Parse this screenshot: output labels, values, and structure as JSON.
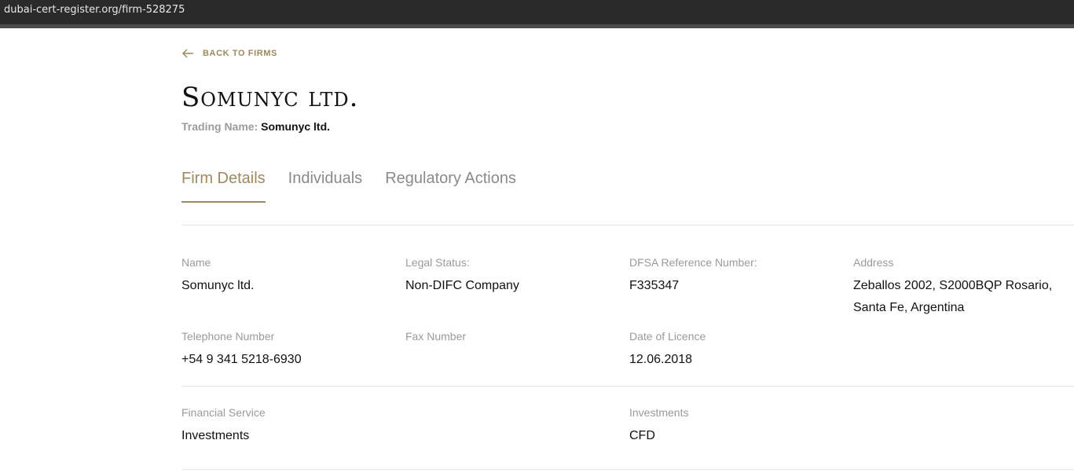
{
  "browser": {
    "url": "dubai-cert-register.org/firm-528275"
  },
  "back_link": {
    "label": "BACK TO FIRMS"
  },
  "firm": {
    "name": "Somunyc ltd.",
    "trading_name_label": "Trading Name: ",
    "trading_name": "Somunyc ltd."
  },
  "tabs": [
    {
      "label": "Firm Details",
      "active": true
    },
    {
      "label": "Individuals",
      "active": false
    },
    {
      "label": "Regulatory Actions",
      "active": false
    }
  ],
  "details": {
    "name": {
      "label": "Name",
      "value": "Somunyc ltd."
    },
    "legal_status": {
      "label": "Legal Status:",
      "value": "Non-DIFC Company"
    },
    "dfsa_ref": {
      "label": "DFSA Reference Number:",
      "value": "F335347"
    },
    "address": {
      "label": "Address",
      "value": "Zeballos 2002, S2000BQP Rosario, Santa Fe, Argentina"
    },
    "telephone": {
      "label": "Telephone Number",
      "value": "+54 9 341 5218-6930"
    },
    "fax": {
      "label": "Fax Number",
      "value": ""
    },
    "licence_date": {
      "label": "Date of Licence",
      "value": "12.06.2018"
    }
  },
  "services": {
    "financial_service": {
      "label": "Financial Service",
      "value": "Investments"
    },
    "investments": {
      "label": "Investments",
      "value": "CFD"
    }
  },
  "colors": {
    "accent": "#a0895a",
    "muted": "#9a9a9a",
    "text": "#111111"
  }
}
